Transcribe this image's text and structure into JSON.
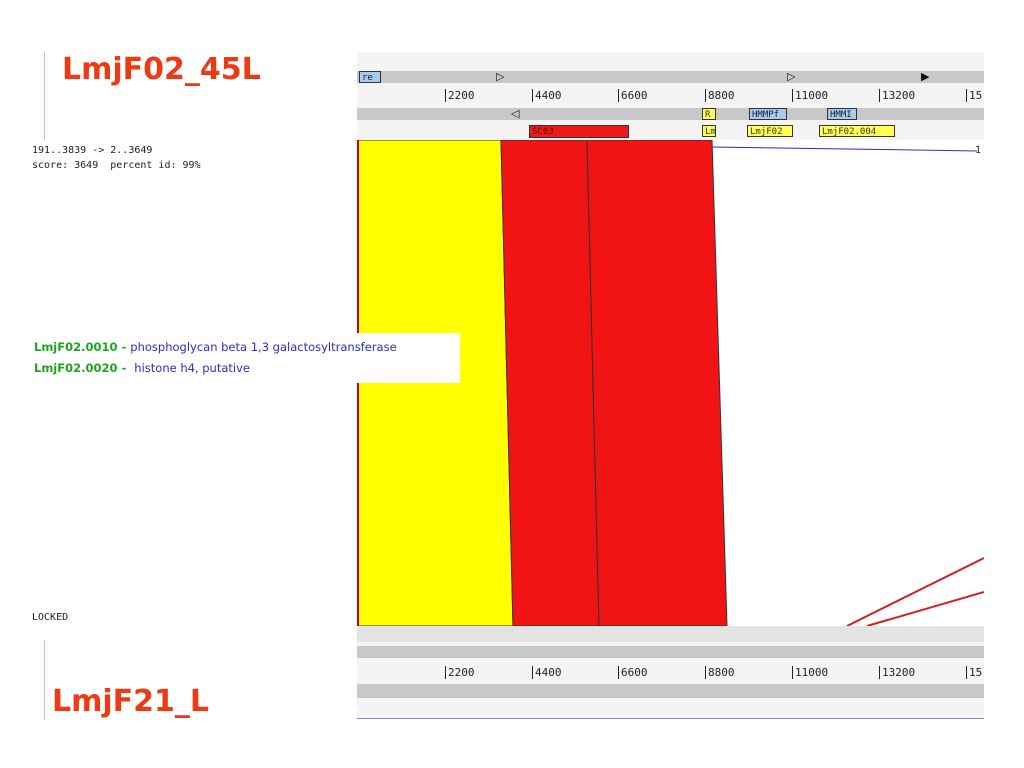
{
  "top_title": "LmjF02_45L",
  "bottom_title": "LmjF21_L",
  "alignment_info": {
    "range": "191..3839 -> 2..3649",
    "score_line": "score: 3649  percent id: 99%"
  },
  "status": "LOCKED",
  "top_ruler_ticks": [
    "2200",
    "4400",
    "6600",
    "8800",
    "11000",
    "13200",
    "15"
  ],
  "bottom_ruler_ticks": [
    "2200",
    "4400",
    "6600",
    "8800",
    "11000",
    "13200",
    "15"
  ],
  "top_features": {
    "row1_label": "re",
    "row2_labels": [
      "R",
      "HMMPf",
      "HMMI"
    ],
    "row3_labels": [
      "SC03",
      "Lm",
      "LmjF02",
      "LmjF02.004"
    ],
    "row3_end_label": "1"
  },
  "popup": {
    "genes": [
      {
        "id": "LmjF02.0010",
        "separator": " - ",
        "description": "phosphoglycan beta 1,3 galactosyltransferase"
      },
      {
        "id": "LmjF02.0020",
        "separator": " -  ",
        "description": "histone h4, putative"
      }
    ]
  },
  "colors": {
    "title": "#ee3a13",
    "yellow_block": "#ffff00",
    "red_block": "#f21414",
    "gene_id": "#1ea31e",
    "gene_desc": "#2b2bd0"
  }
}
